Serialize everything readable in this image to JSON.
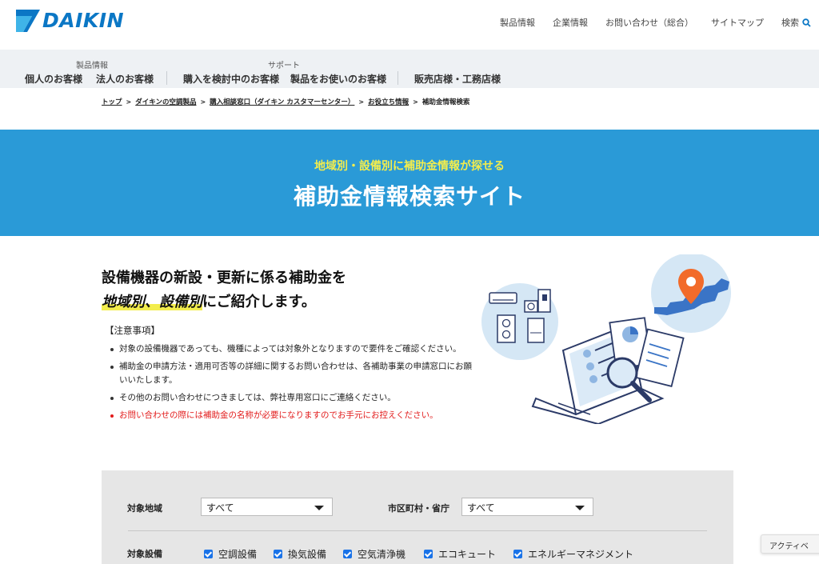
{
  "header": {
    "logo_text": "DAIKIN",
    "nav": [
      "製品情報",
      "企業情報",
      "お問い合わせ（総合）",
      "サイトマップ"
    ],
    "search_label": "検索"
  },
  "subnav": {
    "group_products": "製品情報",
    "group_support": "サポート",
    "items": [
      "個人のお客様",
      "法人のお客様",
      "購入を検討中のお客様",
      "製品をお使いのお客様",
      "販売店様・工務店様"
    ]
  },
  "breadcrumb": [
    "トップ",
    "ダイキンの空調製品",
    "購入相談窓口（ダイキン カスタマーセンター）",
    "お役立ち情報",
    "補助金情報検索"
  ],
  "hero": {
    "subtitle": "地域別・設備別に補助金情報が探せる",
    "title": "補助金情報検索サイト"
  },
  "intro": {
    "line1": "設備機器の新設・更新に係る補助金を",
    "line2_highlight": "地域別、設備別",
    "line2_rest": "にご紹介します。",
    "notice_heading": "【注意事項】",
    "notices": [
      "対象の設備機器であっても、機種によっては対象外となりますので要件をご確認ください。",
      "補助金の申請方法・適用可否等の詳細に関するお問い合わせは、各補助事業の申請窓口にお願いいたします。",
      "その他のお問い合わせにつきましては、弊社専用窓口にご連絡ください。",
      "お問い合わせの際には補助金の名称が必要になりますのでお手元にお控えください。"
    ]
  },
  "search": {
    "region_label": "対象地域",
    "region_value": "すべて",
    "city_label": "市区町村・省庁",
    "city_value": "すべて",
    "equipment_label": "対象設備",
    "equipment": [
      "空調設備",
      "換気設備",
      "空気清浄機",
      "エコキュート",
      "エネルギーマネジメント"
    ]
  },
  "overlay": {
    "activate": "アクティベ"
  },
  "colors": {
    "brand_blue": "#0b77c5",
    "hero_blue": "#2a9ad7",
    "hero_yellow": "#f3ed4d",
    "warning_red": "#e21b1b"
  }
}
